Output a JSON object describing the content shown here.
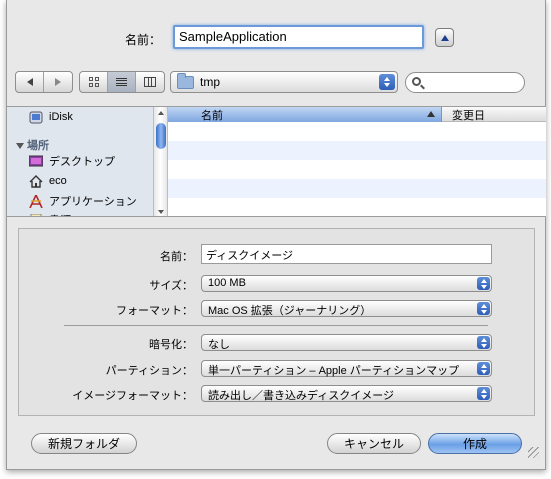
{
  "save_as": {
    "label": "名前：",
    "value": "SampleApplication"
  },
  "toolbar": {
    "location": "tmp",
    "search_placeholder": ""
  },
  "sidebar": {
    "items": [
      {
        "label": "iDisk",
        "icon": "idisk-icon"
      },
      {
        "label": "デスクトップ",
        "icon": "desktop-icon"
      },
      {
        "label": "eco",
        "icon": "home-icon"
      },
      {
        "label": "アプリケーション",
        "icon": "applications-icon"
      },
      {
        "label": "書類",
        "icon": "documents-icon"
      }
    ],
    "section_label": "場所"
  },
  "file_list": {
    "columns": [
      "名前",
      "変更日"
    ]
  },
  "options": {
    "name_label": "名前：",
    "name_value": "ディスクイメージ",
    "size_label": "サイズ：",
    "size_value": "100 MB",
    "format_label": "フォーマット：",
    "format_value": "Mac OS 拡張（ジャーナリング）",
    "encryption_label": "暗号化：",
    "encryption_value": "なし",
    "partitions_label": "パーティション：",
    "partitions_value": "単一パーティション – Apple パーティションマップ",
    "image_format_label": "イメージフォーマット：",
    "image_format_value": "読み出し／書き込みディスクイメージ"
  },
  "buttons": {
    "new_folder": "新規フォルダ",
    "cancel": "キャンセル",
    "create": "作成"
  },
  "colors": {
    "accent": "#6aa0e6",
    "sidebar_bg": "#e0e6ee"
  }
}
